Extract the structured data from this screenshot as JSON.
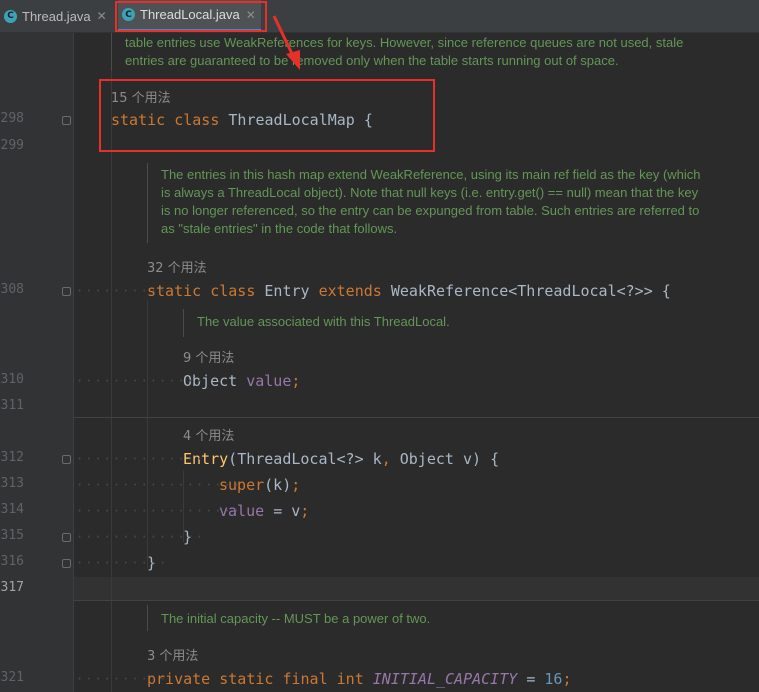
{
  "tabs": [
    {
      "label": "Thread.java",
      "icon": "c-class-icon",
      "active": false
    },
    {
      "label": "ThreadLocal.java",
      "icon": "c-class-icon",
      "active": true
    }
  ],
  "colors": {
    "accent": "#4a88c7",
    "annotation": "#e8302a",
    "doc_comment": "#629755",
    "keyword": "#cc7832"
  },
  "doc_top": {
    "line1": "table entries use WeakReferences for keys. However, since reference queues are not used, stale",
    "line2": "entries are guaranteed to be removed only when the table starts running out of space."
  },
  "line_numbers": [
    "298",
    "299",
    "308",
    "310",
    "311",
    "312",
    "313",
    "314",
    "315",
    "316",
    "317",
    "321"
  ],
  "usages": {
    "class_map": "15 个用法",
    "entry_class": "32 个用法",
    "value_field": "9 个用法",
    "constructor": "4 个用法",
    "initial_capacity": "3 个用法"
  },
  "code": {
    "l298": {
      "kw1": "static",
      "kw2": "class",
      "name": "ThreadLocalMap",
      "brace": "{"
    },
    "l308": {
      "kw1": "static",
      "kw2": "class",
      "name": "Entry",
      "kw3": "extends",
      "rest": "WeakReference<ThreadLocal<?>>",
      "brace": "{"
    },
    "l310": {
      "type": "Object",
      "name": "value",
      "semi": ";"
    },
    "l312": {
      "name": "Entry",
      "open": "(",
      "params1": "ThreadLocal<?> k",
      "comma": ",",
      "params2": "Object v",
      "close": ")",
      "brace": "{"
    },
    "l313": {
      "call": "super",
      "args": "(k)",
      "semi": ";"
    },
    "l314": {
      "lhs": "value",
      "op": "=",
      "rhs": "v",
      "semi": ";"
    },
    "l315": {
      "brace": "}"
    },
    "l316": {
      "brace": "}"
    },
    "l321": {
      "kw1": "private",
      "kw2": "static",
      "kw3": "final",
      "kw4": "int",
      "name": "INITIAL_CAPACITY",
      "op": "=",
      "num": "16",
      "semi": ";"
    }
  },
  "doc_entry": {
    "line1": "The entries in this hash map extend WeakReference, using its main ref field as the key (which",
    "line2": "is always a ThreadLocal object). Note that null keys (i.e. entry.get() == null) mean that the key",
    "line3": "is no longer referenced, so the entry can be expunged from table. Such entries are referred to",
    "line4": "as \"stale entries\" in the code that follows."
  },
  "doc_value": "The value associated with this ThreadLocal.",
  "doc_capacity": "The initial capacity -- MUST be a power of two."
}
